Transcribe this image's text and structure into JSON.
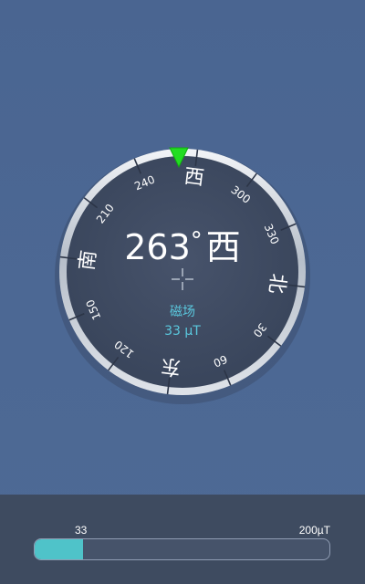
{
  "compass": {
    "heading_deg": 263,
    "degree_symbol": "°",
    "heading_direction": "西",
    "cardinals": [
      "北",
      "东",
      "南",
      "西"
    ],
    "tick_labels": [
      "30",
      "60",
      "120",
      "150",
      "210",
      "240",
      "300",
      "330"
    ],
    "field_label": "磁场",
    "field_value": "33 µT",
    "pointer_color": "#22dd22"
  },
  "field_bar": {
    "current_label": "33",
    "max_label": "200µT",
    "current_value": 33,
    "max_value": 200,
    "fill_color": "#4fc3c9"
  }
}
